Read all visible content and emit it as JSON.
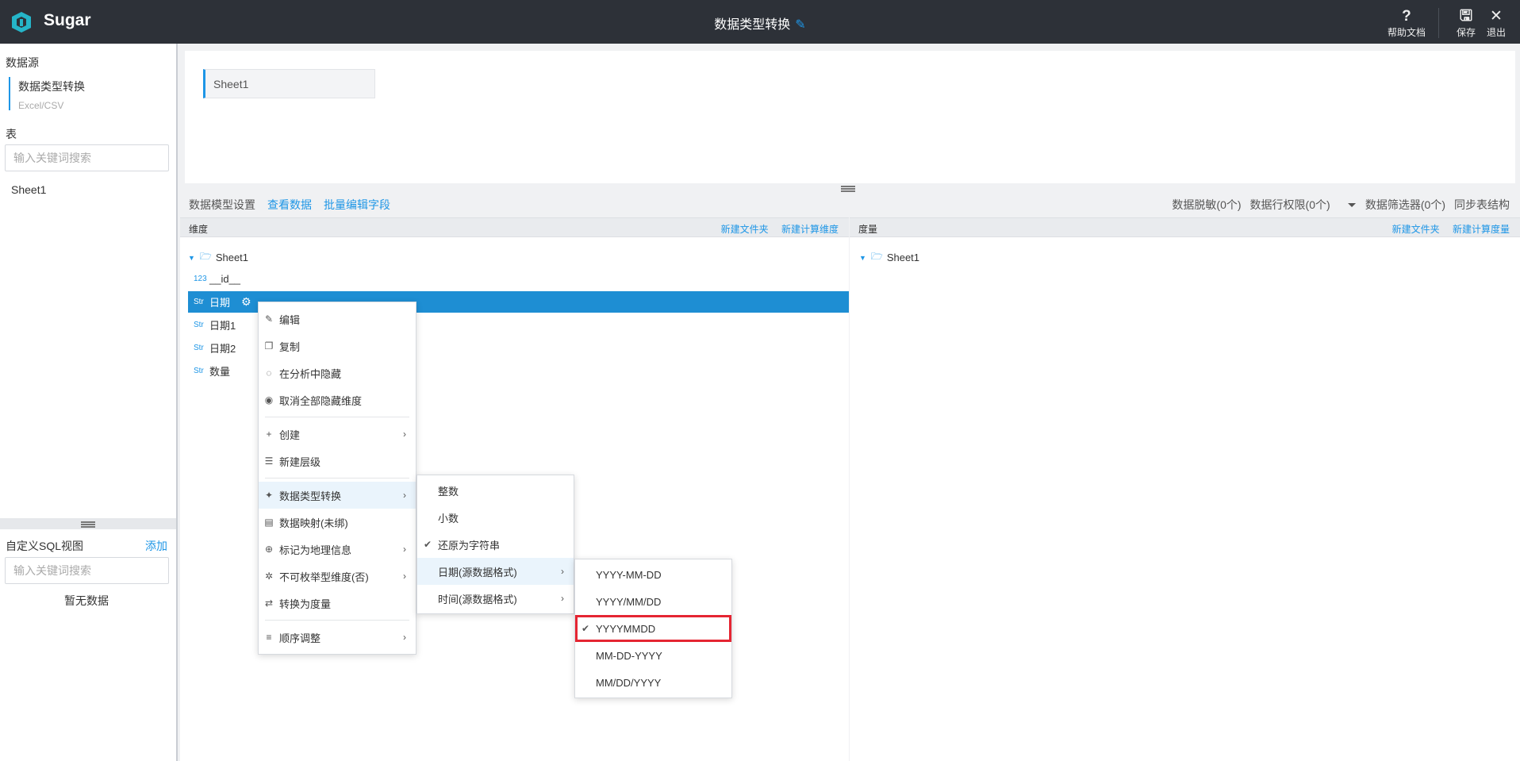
{
  "header": {
    "brand": "Sugar",
    "title": "数据类型转换",
    "actions": [
      {
        "icon": "help-icon",
        "label": "帮助文档"
      },
      {
        "icon": "save-icon",
        "label": "保存"
      },
      {
        "icon": "close-icon",
        "label": "退出"
      }
    ]
  },
  "left": {
    "datasource_label": "数据源",
    "datasource_name": "数据类型转换",
    "datasource_type": "Excel/CSV",
    "table_label": "表",
    "search_placeholder": "输入关键词搜索",
    "tables": [
      "Sheet1"
    ],
    "sql_label": "自定义SQL视图",
    "sql_add": "添加",
    "sql_search_placeholder": "输入关键词搜索",
    "sql_empty": "暂无数据"
  },
  "preview": {
    "sheet": "Sheet1"
  },
  "tabs": {
    "model_settings": "数据模型设置",
    "view_data": "查看数据",
    "batch_edit": "批量编辑字段",
    "masking": "数据脱敏(0个)",
    "row_permission": "数据行权限(0个)",
    "filter": "数据筛选器(0个)",
    "sync": "同步表结构"
  },
  "dimensions": {
    "title": "维度",
    "new_folder": "新建文件夹",
    "new_calc": "新建计算维度",
    "folder": "Sheet1",
    "fields": [
      {
        "tag": "123",
        "name": "__id__"
      },
      {
        "tag": "Str",
        "name": "日期",
        "selected": true
      },
      {
        "tag": "Str",
        "name": "日期1"
      },
      {
        "tag": "Str",
        "name": "日期2"
      },
      {
        "tag": "Str",
        "name": "数量"
      }
    ]
  },
  "measures": {
    "title": "度量",
    "new_folder": "新建文件夹",
    "new_calc": "新建计算度量",
    "folder": "Sheet1"
  },
  "context_menu": {
    "items": [
      "编辑",
      "复制",
      "在分析中隐藏",
      "取消全部隐藏维度",
      "创建",
      "新建层级",
      "数据类型转换",
      "数据映射(未绑)",
      "标记为地理信息",
      "不可枚举型维度(否)",
      "转换为度量",
      "顺序调整"
    ]
  },
  "type_menu": {
    "items": [
      "整数",
      "小数",
      "还原为字符串",
      "日期(源数据格式)",
      "时间(源数据格式)"
    ]
  },
  "date_menu": {
    "items": [
      "YYYY-MM-DD",
      "YYYY/MM/DD",
      "YYYYMMDD",
      "MM-DD-YYYY",
      "MM/DD/YYYY"
    ],
    "selected": "YYYYMMDD"
  },
  "colors": {
    "accent": "#1e96e6",
    "topbar": "#2d3138",
    "selected_row": "#1e8ed3",
    "highlight": "#e52532"
  }
}
